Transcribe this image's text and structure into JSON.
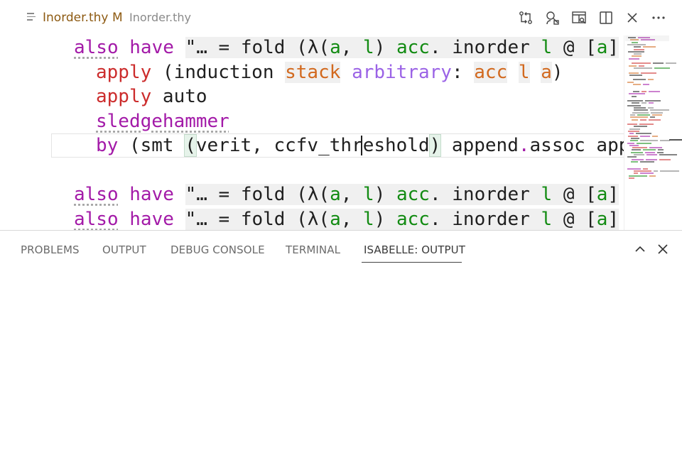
{
  "tab": {
    "filename": "Inorder.thy",
    "modified": "M",
    "breadcrumb": "Inorder.thy"
  },
  "editor_actions": [
    "compare-changes-icon",
    "search-person-icon",
    "preview-icon",
    "split-editor-icon",
    "close-icon",
    "more-actions-icon"
  ],
  "code": {
    "line1": {
      "kw1": "also",
      "kw2": "have",
      "s1": "\"… = fold (λ(",
      "a": "a",
      "s2": ", ",
      "l": "l",
      "s3": ") ",
      "acc": "acc",
      "s4": ". inorder ",
      "l2": "l",
      "s5": " @ [",
      "a2": "a",
      "s6": "]"
    },
    "line2": {
      "kw": "apply",
      "s1": " (induction ",
      "stack": "stack",
      "s2": " ",
      "arbitrary": "arbitrary",
      "s3": ": ",
      "acc": "acc",
      "s4": " ",
      "l": "l",
      "s5": " ",
      "a": "a",
      "s6": ")"
    },
    "line3": {
      "kw": "apply",
      "s1": " auto"
    },
    "line4": {
      "kw": "sledgehammer"
    },
    "line5": {
      "kw": "by",
      "s1": " (smt ",
      "b1": "(",
      "s2": "verit, ccfv_threshold",
      "b2": ")",
      "s3": " append",
      "dot": ".",
      "s4": "assoc app"
    },
    "line6": {
      "kw1": "also",
      "kw2": "have",
      "s1": "\"… = fold (λ(",
      "a": "a",
      "s2": ", ",
      "l": "l",
      "s3": ") ",
      "acc": "acc",
      "s4": ". inorder ",
      "l2": "l",
      "s5": " @ [",
      "a2": "a",
      "s6": "]"
    },
    "line7": {
      "kw1": "also",
      "kw2": "have",
      "s1": "\"… = fold (λ(",
      "a": "a",
      "s2": ", ",
      "l": "l",
      "s3": ") ",
      "acc": "acc",
      "s4": ". inorder ",
      "l2": "l",
      "s5": " @ [",
      "a2": "a",
      "s6": "]"
    }
  },
  "panel": {
    "tabs": [
      "PROBLEMS",
      "OUTPUT",
      "DEBUG CONSOLE",
      "TERMINAL",
      "ISABELLE: OUTPUT"
    ],
    "active_tab": "ISABELLE: OUTPUT",
    "actions": [
      "chevron-up-icon",
      "close-icon"
    ]
  },
  "colors": {
    "keyword": "#a31aa8",
    "command": "#cc2c2c",
    "variable": "#128b12",
    "skolem": "#d2691e",
    "attribute": "#9b63e6",
    "tab_modified": "#8d5a12"
  }
}
